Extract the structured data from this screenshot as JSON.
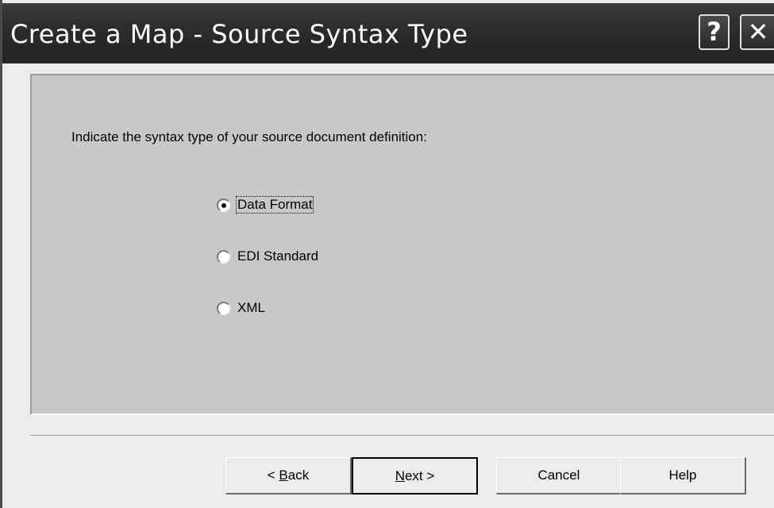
{
  "window": {
    "title": "Create a Map - Source Syntax Type",
    "help_button": "?",
    "close_button": "✕"
  },
  "prompt": "Indicate the syntax type of your source document definition:",
  "options": [
    {
      "label": "Data Format",
      "selected": true
    },
    {
      "label": "EDI Standard",
      "selected": false
    },
    {
      "label": "XML",
      "selected": false
    }
  ],
  "buttons": {
    "back": {
      "prefix": "< ",
      "accel": "B",
      "rest": "ack"
    },
    "next": {
      "accel": "N",
      "rest": "ext >"
    },
    "cancel": "Cancel",
    "help": "Help"
  }
}
